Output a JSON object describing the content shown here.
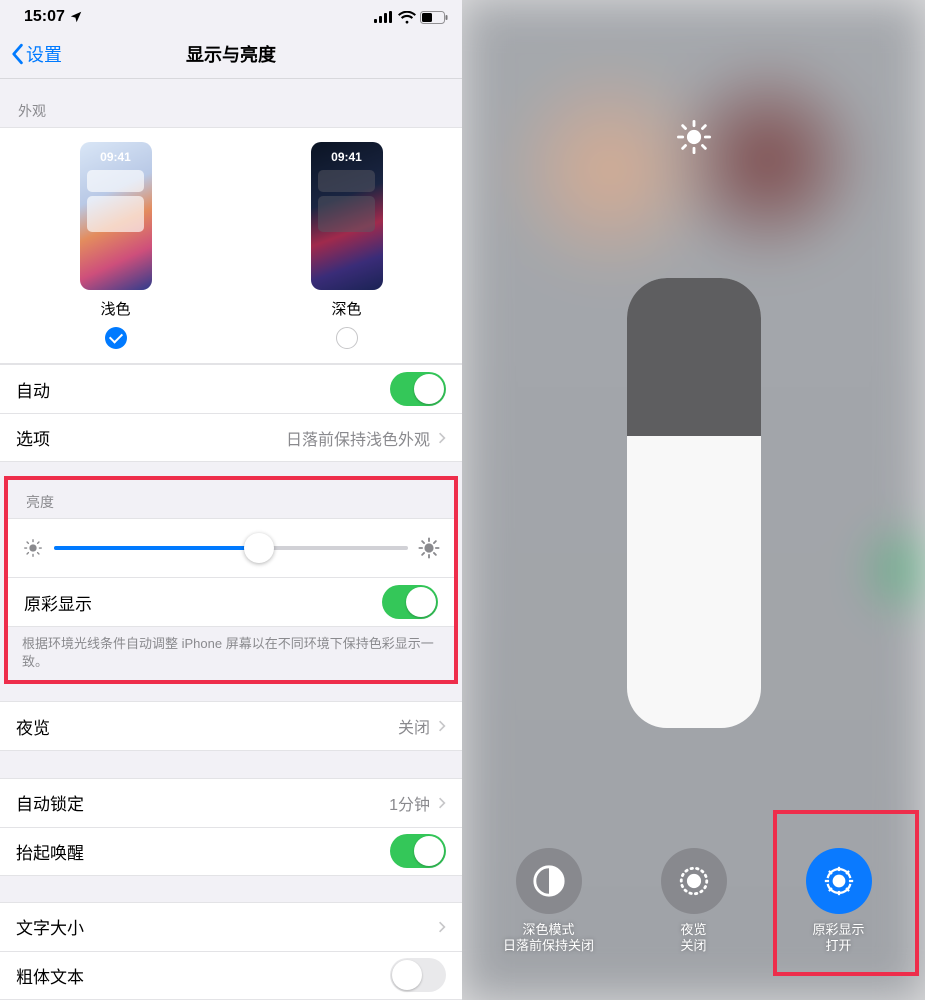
{
  "statusbar": {
    "time": "15:07"
  },
  "nav": {
    "back": "设置",
    "title": "显示与亮度"
  },
  "appearance": {
    "section_label": "外观",
    "preview_time": "09:41",
    "light_label": "浅色",
    "dark_label": "深色",
    "selected": "light"
  },
  "rows": {
    "auto": {
      "label": "自动",
      "on": true
    },
    "options": {
      "label": "选项",
      "value": "日落前保持浅色外观"
    }
  },
  "brightness": {
    "section_label": "亮度",
    "slider_percent": 58,
    "truetone_label": "原彩显示",
    "truetone_on": true,
    "truetone_footer": "根据环境光线条件自动调整 iPhone 屏幕以在不同环境下保持色彩显示一致。"
  },
  "nightshift": {
    "label": "夜览",
    "value": "关闭"
  },
  "autolock": {
    "label": "自动锁定",
    "value": "1分钟"
  },
  "raise": {
    "label": "抬起唤醒",
    "on": true
  },
  "textsize": {
    "label": "文字大小"
  },
  "bold": {
    "label": "粗体文本",
    "on": false
  },
  "cc": {
    "brightness_level_percent": 65,
    "buttons": {
      "darkmode": {
        "title": "深色模式",
        "sub": "日落前保持关闭"
      },
      "nightshift": {
        "title": "夜览",
        "sub": "关闭"
      },
      "truetone": {
        "title": "原彩显示",
        "sub": "打开"
      }
    }
  }
}
